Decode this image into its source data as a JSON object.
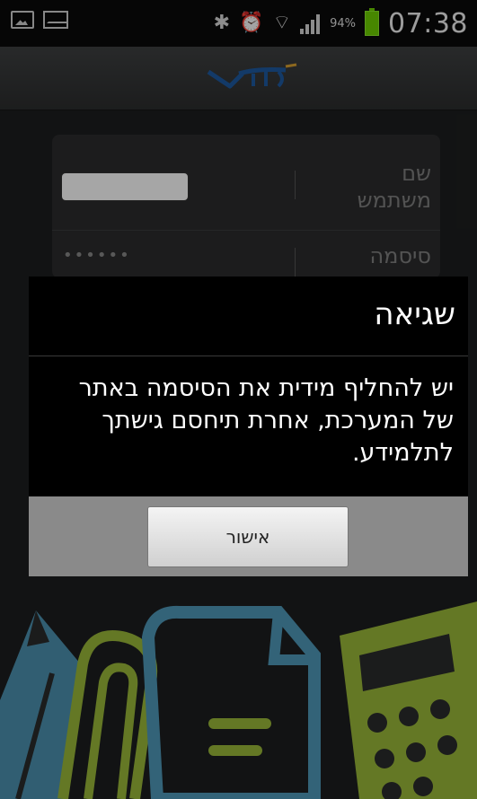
{
  "status_bar": {
    "battery_percent": "94%",
    "time": "07:38",
    "icons": [
      "image-notification-icon",
      "mail-notification-icon",
      "bluetooth-icon",
      "alarm-icon",
      "wifi-icon",
      "signal-icon",
      "battery-icon"
    ],
    "battery_color": "#6ed000"
  },
  "app_header": {
    "logo": "app-logo"
  },
  "login_form": {
    "username_label": "שם משתמש",
    "username_value": "",
    "password_label": "סיסמה",
    "password_value": "••••••"
  },
  "dialog": {
    "title": "שגיאה",
    "message": "יש להחליף מידית את הסיסמה באתר של המערכת, אחרת תיחסם גישתך לתלמידע.",
    "ok_label": "אישור"
  },
  "colors": {
    "background": "#1d1e1f",
    "dialog_background": "#000000",
    "dialog_footer": "#8a8a8a",
    "illustration_blue": "#4f98b8",
    "illustration_green": "#9ab83a"
  }
}
